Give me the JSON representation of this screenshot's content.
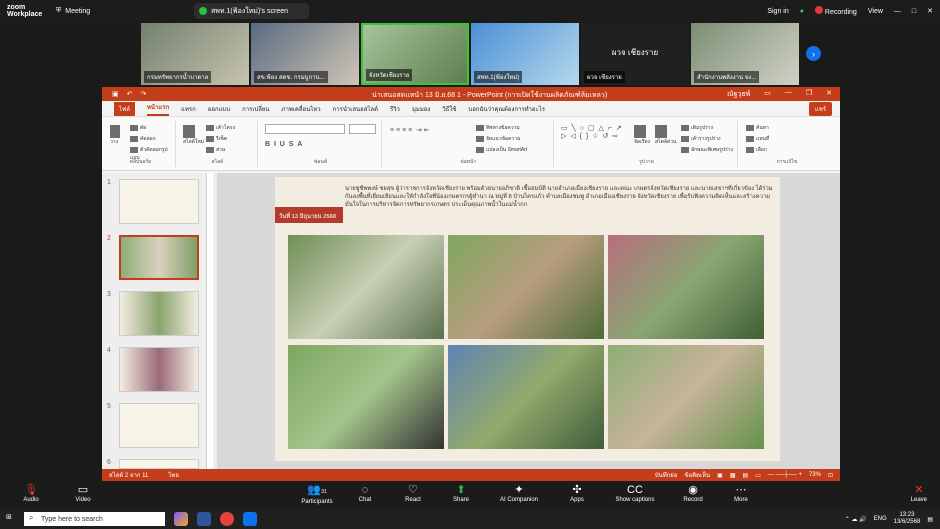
{
  "zoom": {
    "logo": [
      "zoom",
      "Workplace"
    ],
    "meeting_label": "Meeting",
    "share_label": "สพท.1(ฟ้องใหม่)'s screen",
    "sign_in": "Sign in",
    "recording": "Recording",
    "view": "View"
  },
  "participants": [
    {
      "label": "กรมทรัพยากรน้ำบาดาล"
    },
    {
      "label": "สข.ฟ้อง สตข. กรมบูกาน..."
    },
    {
      "label": "จังหวัดเชียงราย"
    },
    {
      "label": "สพท.1(ฟ้องใหม่)"
    },
    {
      "label": "ผวจ เชียงราย",
      "center_name": "ผวจ เชียงราย"
    },
    {
      "label": "สำนักงานพลังงาน จง..."
    }
  ],
  "ppt": {
    "file_title": "น่าเสนอสดแหนำ 13 มิ.ย.68 1 - PowerPoint (การเปิดใช้งานผลิตภัณฑ์ล้มเหลว)",
    "user": "ณัฐวุธพ์",
    "tabs": [
      "ไฟล์",
      "หน้าแรก",
      "แทรก",
      "ออกแบบ",
      "การเปลี่ยน",
      "ภาพเคลื่อนไหว",
      "การนำเสนอสไลด์",
      "รีวิว",
      "มุมมอง",
      "วิธีใช้",
      "บอกฉันว่าคุณต้องการทำอะไร"
    ],
    "share": "แชร์",
    "groups": [
      "คลิปบอร์ด",
      "สไลด์",
      "ฟอนต์",
      "ย่อหน้า",
      "รูปวาด",
      "การแก้ไข"
    ],
    "ribbon_labels": [
      "วาง",
      "ตัด",
      "คัดลอก",
      "ตัวคัดลอกรูปแบบ",
      "สไลด์ใหม่",
      "เค้าโครง",
      "รีเซ็ต",
      "ส่วน",
      "จัดเรียง",
      "ค้นหา",
      "แทนที่",
      "เลือก",
      "สไตล์ด่วน",
      "เติมรูปร่าง",
      "เค้าร่างรูปร่าง",
      "ลักษณะพิเศษรูปร่าง",
      "ทิศทางข้อความ",
      "จัดแนวข้อความ",
      "แปลงเป็น SmartArt"
    ],
    "thumb_numbers": [
      "1",
      "2",
      "3",
      "4",
      "5",
      "6"
    ],
    "slide_text": "นายชูชีพพงษ์ ชยสุข ผู้ว่าราชการจังหวัดเชียงราย พร้อมด้วยนายอภิชาติ เชื้อสมบัติ นายอำเภอเมืองเชียงราย และคณะ เกษตรจังหวัดเชียงราย และนายเลขาฯที่เกี่ยวข้อง ได้ร่วมกันลงพื้นที่เยี่ยมเยียนและให้กำลังใจพี่น้องเกษตรกรผู้ทำนา ณ หมู่ที่ 8 บ้านไตรแก้ว ตำบลเมืองชมพู อำเภอเมืองเชียงราย จังหวัดเชียงราย เพื่อรับฟังความคิดเห็นและสร้างความมั่นใจในการบริหารจัดการทรัพยากรเกษตร ประเด็นคุณภาพน้ำในแม่น้ำกก",
    "date_tag": "วันที่ 13 มิถุนายน 2568",
    "status_left": "สไลด์ 2 จาก 11",
    "status_lang": "ไทย",
    "status_notes": "บันทึกย่อ",
    "status_comments": "ข้อคิดเห็น",
    "zoom": "73%"
  },
  "controls": [
    "Audio",
    "Video",
    "Participants",
    "Chat",
    "React",
    "Share",
    "AI Companion",
    "Apps",
    "Show captions",
    "Record",
    "More",
    "Leave"
  ],
  "participant_count": "31",
  "taskbar": {
    "search": "Type here to search",
    "lang": "ENG",
    "time": "13:23",
    "date": "13/6/2568"
  },
  "colors": {
    "ppt_accent": "#c43e1c",
    "zoom_blue": "#0e72ed",
    "record_red": "#e53935",
    "share_green": "#29b94a"
  }
}
